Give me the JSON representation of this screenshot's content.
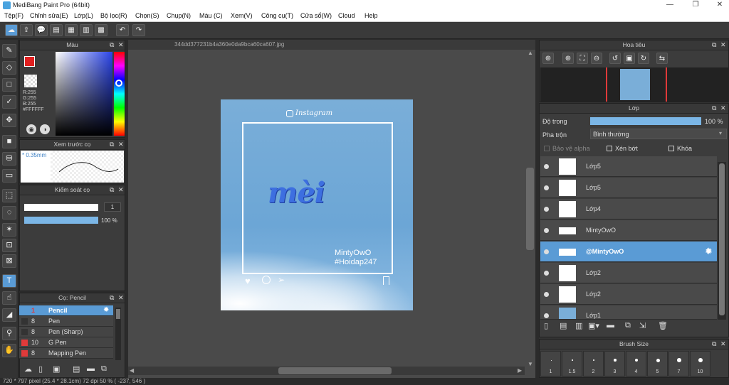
{
  "window": {
    "title": "MediBang Paint Pro (64bit)"
  },
  "menu": [
    "Tệp(F)",
    "Chỉnh sửa(E)",
    "Lớp(L)",
    "Bộ lọc(R)",
    "Chọn(S)",
    "Chụp(N)",
    "Màu (C)",
    "Xem(V)",
    "Công cụ(T)",
    "Cửa sổ(W)",
    "Cloud",
    "Help"
  ],
  "color_panel": {
    "title": "Màu",
    "r": "R:255",
    "g": "G:255",
    "b": "B:255",
    "hex": "#FFFFFF"
  },
  "brush_preview": {
    "title": "Xem trước cọ",
    "size": "* 0.35mm"
  },
  "brush_control": {
    "title": "Kiểm soát cọ",
    "size_value": "1",
    "opacity_value": "100 %",
    "opacity_fraction": 1.0
  },
  "brush_list": {
    "title": "Cọ: Pencil",
    "items": [
      {
        "size": "1",
        "name": "Pencil",
        "color": "#ffffff",
        "selected": true
      },
      {
        "size": "8",
        "name": "Pen",
        "color": "#333333"
      },
      {
        "size": "8",
        "name": "Pen (Sharp)",
        "color": "#333333"
      },
      {
        "size": "10",
        "name": "G Pen",
        "color": "#e03a3a"
      },
      {
        "size": "8",
        "name": "Mapping Pen",
        "color": "#e03a3a"
      }
    ]
  },
  "document": {
    "tab": "344dd377231b4a360e0da9bca60ca607.jpg",
    "image": {
      "brand": "Instagram",
      "word": "mèi",
      "caption1": "MintyOwO",
      "caption2": "#Hoidap247"
    }
  },
  "navigator": {
    "title": "Hoa tiêu"
  },
  "layer_panel": {
    "title": "Lớp",
    "opacity_label": "Độ trong",
    "opacity_value": "100 %",
    "opacity_fraction": 1.0,
    "blend_label": "Pha trộn",
    "blend_value": "Bình thường",
    "protect_alpha": "Bảo vệ alpha",
    "clipping": "Xén bớt",
    "lock": "Khóa",
    "layers": [
      {
        "name": "Lớp5",
        "selected": false
      },
      {
        "name": "Lớp5",
        "selected": false
      },
      {
        "name": "Lớp4",
        "selected": false
      },
      {
        "name": "MintyOwO",
        "selected": false
      },
      {
        "name": "@MintyOwO",
        "selected": true
      },
      {
        "name": "Lớp2",
        "selected": false
      },
      {
        "name": "Lớp2",
        "selected": false
      },
      {
        "name": "Lớp1",
        "selected": false
      }
    ]
  },
  "brush_size": {
    "title": "Brush Size",
    "sizes": [
      "1",
      "1.5",
      "2",
      "3",
      "4",
      "5",
      "7",
      "10"
    ]
  },
  "status": {
    "text": "720 * 797 pixel   (25.4 * 28.1cm)   72 dpi   50 %   ( -237, 546 )"
  },
  "colors": {
    "accent": "#5a9bd5",
    "fg": "#e02020",
    "bg": "#ffffff"
  }
}
